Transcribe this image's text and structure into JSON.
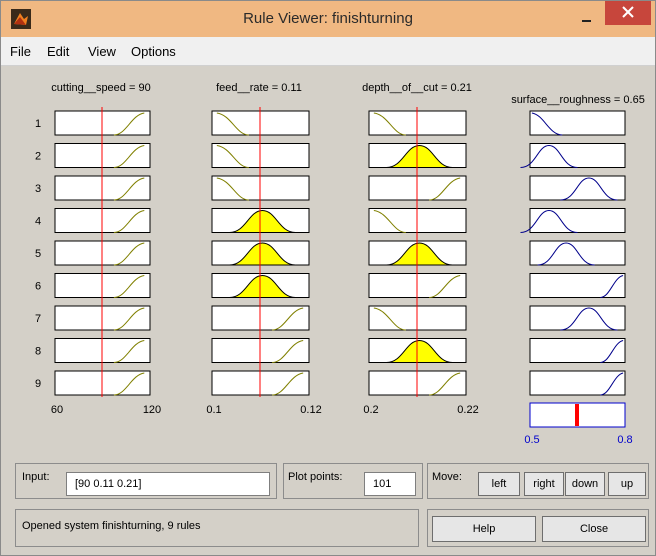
{
  "window": {
    "title": "Rule Viewer: finishturning"
  },
  "menu": [
    "File",
    "Edit",
    "View",
    "Options"
  ],
  "inputs_header": [
    "cutting__speed = 90",
    "feed__rate = 0.11",
    "depth__of__cut = 0.21"
  ],
  "output_header": "surface__roughness = 0.65",
  "rule_numbers": [
    "1",
    "2",
    "3",
    "4",
    "5",
    "6",
    "7",
    "8",
    "9"
  ],
  "axes": [
    {
      "min_label": "60",
      "max_label": "120"
    },
    {
      "min_label": "0.1",
      "max_label": "0.12"
    },
    {
      "min_label": "0.2",
      "max_label": "0.22"
    }
  ],
  "output_axis": {
    "min_label": "0.5",
    "max_label": "0.8"
  },
  "bottom": {
    "input_label": "Input:",
    "input_value": "[90 0.11 0.21]",
    "plot_points_label": "Plot points:",
    "plot_points_value": "101",
    "move_label": "Move:",
    "move_buttons": [
      "left",
      "right",
      "down",
      "up"
    ],
    "status": "Opened system finishturning, 9 rules",
    "help_label": "Help",
    "close_label": "Close"
  },
  "colors": {
    "fill": "#ffff00",
    "redline": "#ff0000",
    "in_curve": "#808000",
    "out_curve": "#00008b"
  }
}
